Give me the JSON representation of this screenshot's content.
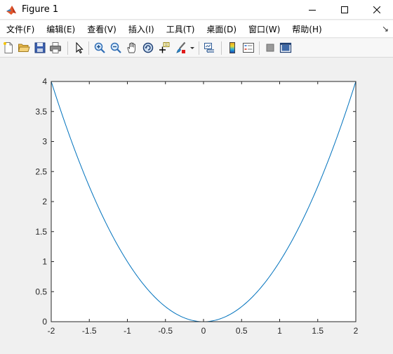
{
  "window": {
    "title": "Figure 1"
  },
  "menu": {
    "items": [
      "文件(F)",
      "编辑(E)",
      "查看(V)",
      "插入(I)",
      "工具(T)",
      "桌面(D)",
      "窗口(W)",
      "帮助(H)"
    ]
  },
  "toolbar": {
    "buttons": [
      "new-figure",
      "open-file",
      "save",
      "print",
      "select-pointer",
      "zoom-in",
      "zoom-out",
      "pan",
      "rotate-3d",
      "data-cursor",
      "brush",
      "brush-dropdown",
      "link-plot",
      "insert-colorbar",
      "insert-legend",
      "hide-plot-tools",
      "show-plot-tools"
    ]
  },
  "colors": {
    "line": "#0072BD",
    "axes": "#262626",
    "figure_bg": "#f0f0f0",
    "axes_bg": "#ffffff"
  },
  "chart_data": {
    "type": "line",
    "function": "y = x^2",
    "xlim": [
      -2,
      2
    ],
    "ylim": [
      0,
      4
    ],
    "xticks": [
      "-2",
      "-1.5",
      "-1",
      "-0.5",
      "0",
      "0.5",
      "1",
      "1.5",
      "2"
    ],
    "yticks": [
      "0",
      "0.5",
      "1",
      "1.5",
      "2",
      "2.5",
      "3",
      "3.5",
      "4"
    ],
    "x": [
      -2,
      -1.75,
      -1.5,
      -1.25,
      -1,
      -0.75,
      -0.5,
      -0.25,
      0,
      0.25,
      0.5,
      0.75,
      1,
      1.25,
      1.5,
      1.75,
      2
    ],
    "y": [
      4,
      3.0625,
      2.25,
      1.5625,
      1,
      0.5625,
      0.25,
      0.0625,
      0,
      0.0625,
      0.25,
      0.5625,
      1,
      1.5625,
      2.25,
      3.0625,
      4
    ],
    "title": "",
    "xlabel": "",
    "ylabel": "",
    "grid": false,
    "legend": "none"
  }
}
